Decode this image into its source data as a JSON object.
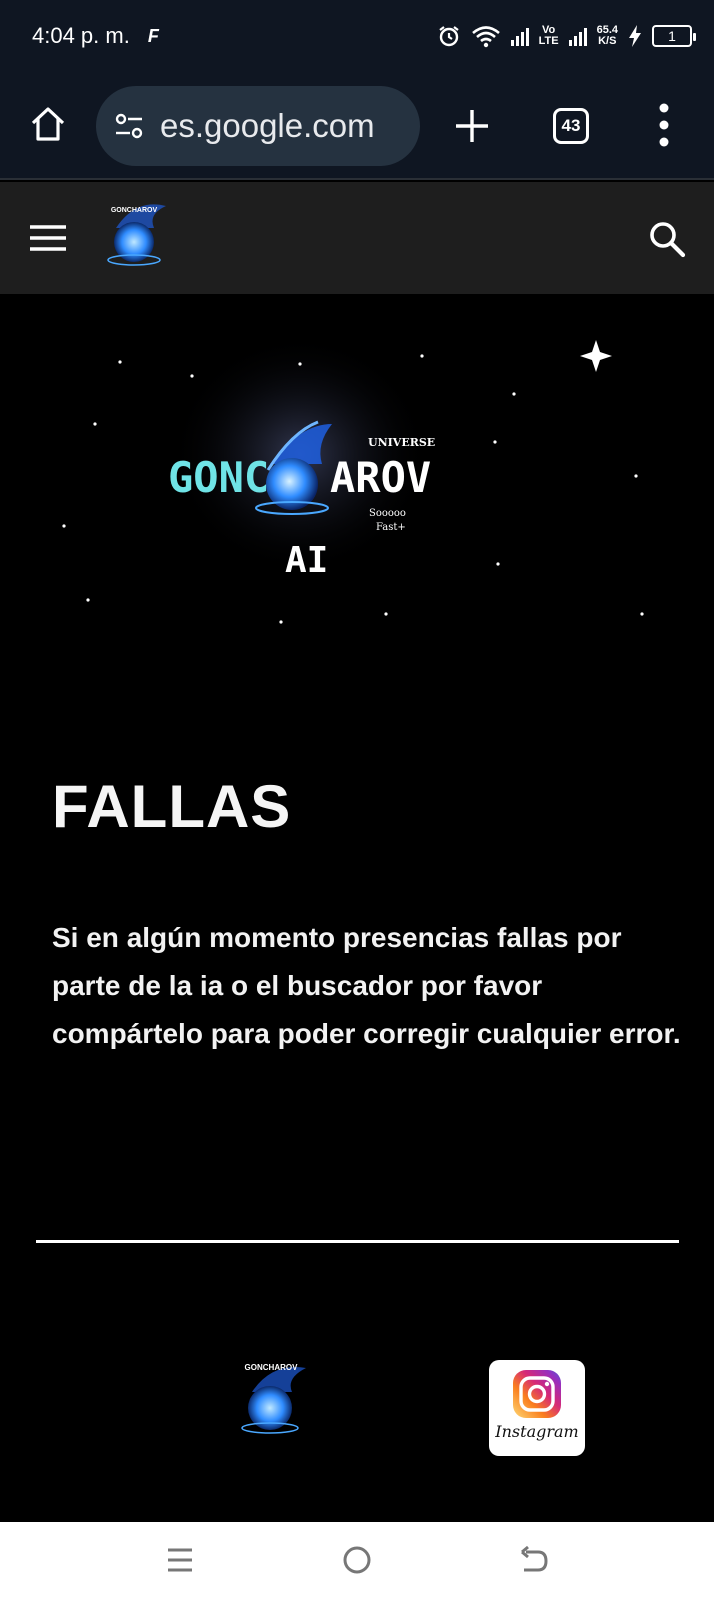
{
  "status_bar": {
    "time": "4:04 p. m.",
    "app_icon": "F",
    "network_label_top": "Vo",
    "network_label_bottom": "LTE",
    "speed_value": "65.4",
    "speed_unit": "K/S",
    "battery": "1"
  },
  "browser": {
    "url": "es.google.com",
    "tab_count": "43"
  },
  "hero": {
    "brand_left": "GONC",
    "brand_right": "AROV",
    "tagline_top": "UNIVERSE",
    "tagline_mid": "Sooooo",
    "tagline_bottom": "Fast+",
    "brand_sub": "AI",
    "small_logo_text": "GONCHAROV"
  },
  "content": {
    "heading": "FALLAS",
    "body": "Si en algún momento presencias fallas por parte de la ia o el buscador por favor compártelo para poder corregir cualquier error."
  },
  "footer": {
    "instagram_label": "Instagram"
  },
  "colors": {
    "background": "#000000",
    "browser_chrome": "#0f1622",
    "site_header": "#1e1e1e",
    "brand_teal": "#6fe3e6",
    "logo_blue": "#2f8cff"
  }
}
